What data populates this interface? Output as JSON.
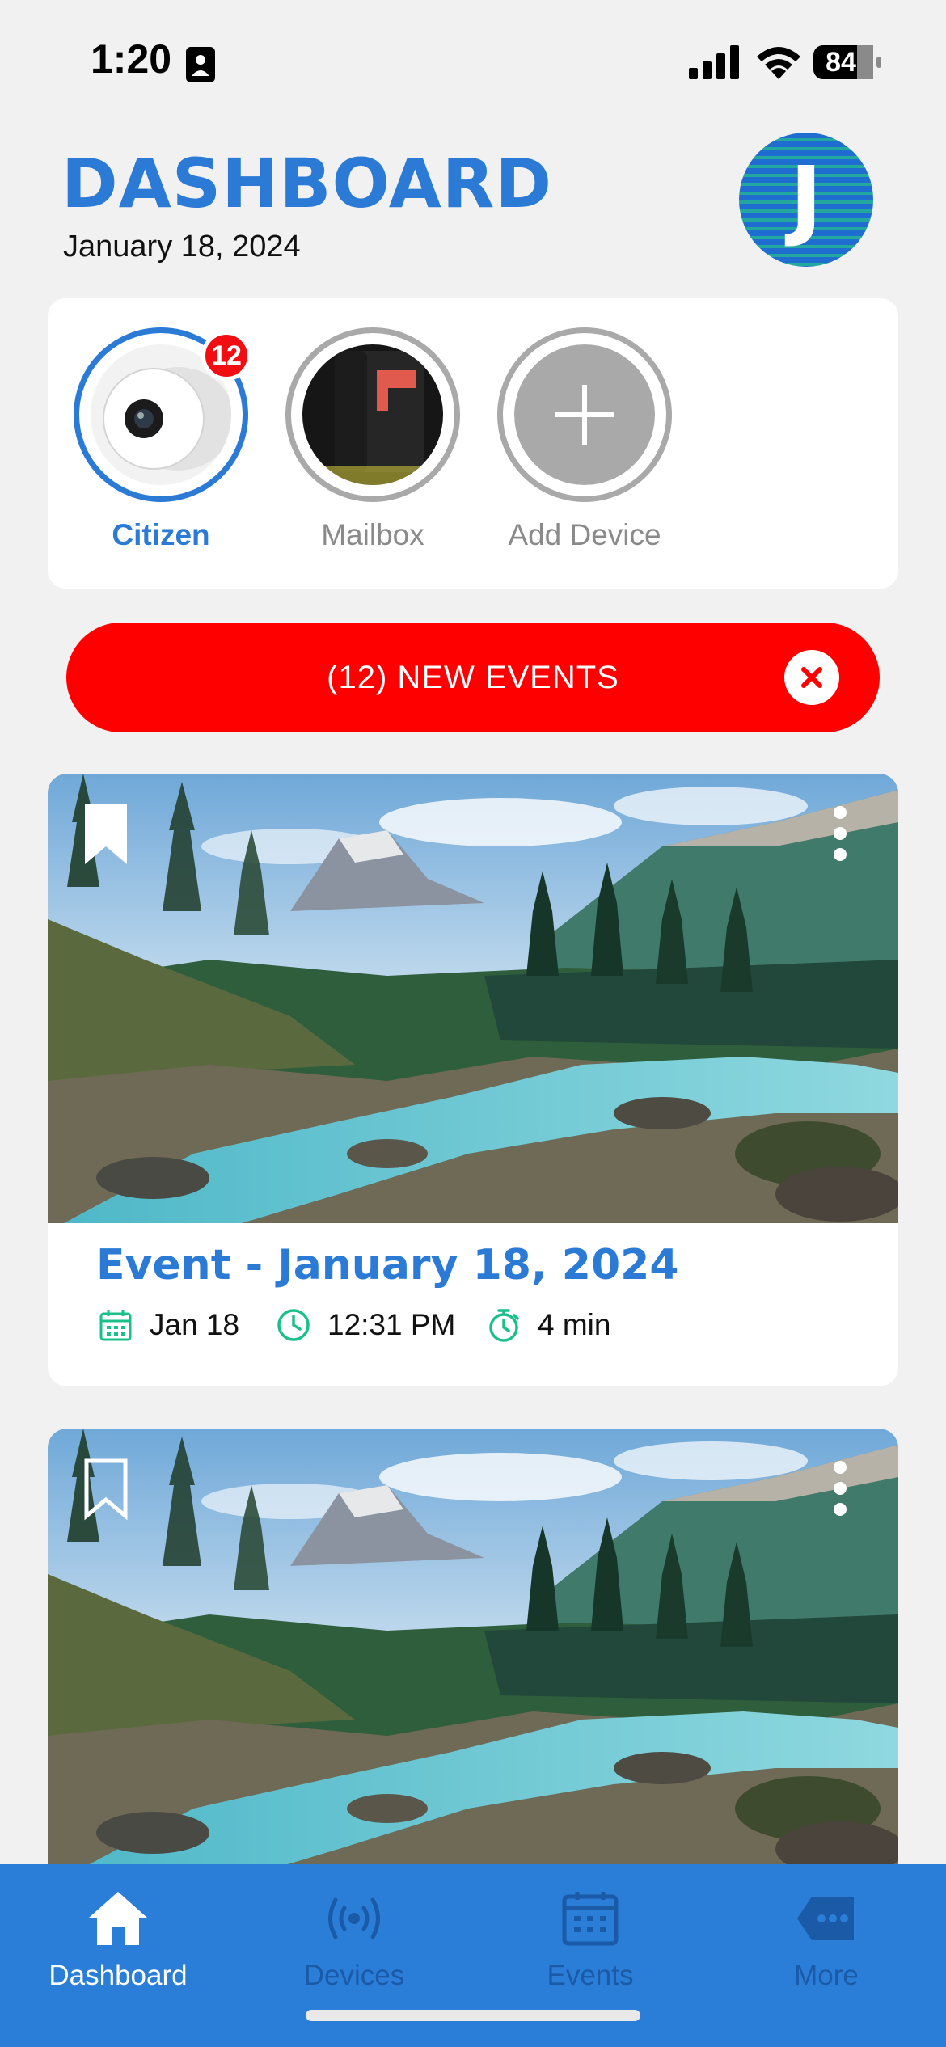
{
  "status_bar": {
    "time": "1:20",
    "battery": "84"
  },
  "header": {
    "title": "DASHBOARD",
    "date": "January 18, 2024",
    "avatar_initial": "J"
  },
  "devices": [
    {
      "label": "Citizen",
      "badge": "12",
      "active": true,
      "icon": "camera-device"
    },
    {
      "label": "Mailbox",
      "active": false,
      "icon": "mailbox-device"
    },
    {
      "label": "Add Device",
      "active": false,
      "icon": "plus-icon"
    }
  ],
  "banner": {
    "label": "(12) NEW EVENTS",
    "close_icon": "close-icon",
    "color": "#fe0000"
  },
  "events": [
    {
      "title": "Event - January 18, 2024",
      "date": "Jan 18",
      "time": "12:31 PM",
      "duration": "4 min",
      "bookmarked": true
    },
    {
      "bookmarked": false
    }
  ],
  "tab_bar": {
    "tabs": [
      {
        "label": "Dashboard",
        "icon": "home-icon",
        "active": true
      },
      {
        "label": "Devices",
        "icon": "broadcast-icon",
        "active": false
      },
      {
        "label": "Events",
        "icon": "calendar-icon",
        "active": false
      },
      {
        "label": "More",
        "icon": "more-tag-icon",
        "active": false
      }
    ]
  },
  "colors": {
    "accent": "#2b7bd6",
    "tab_bar": "#2a7ed8",
    "meta_icon": "#1bbf8a",
    "alert": "#fe0000"
  }
}
